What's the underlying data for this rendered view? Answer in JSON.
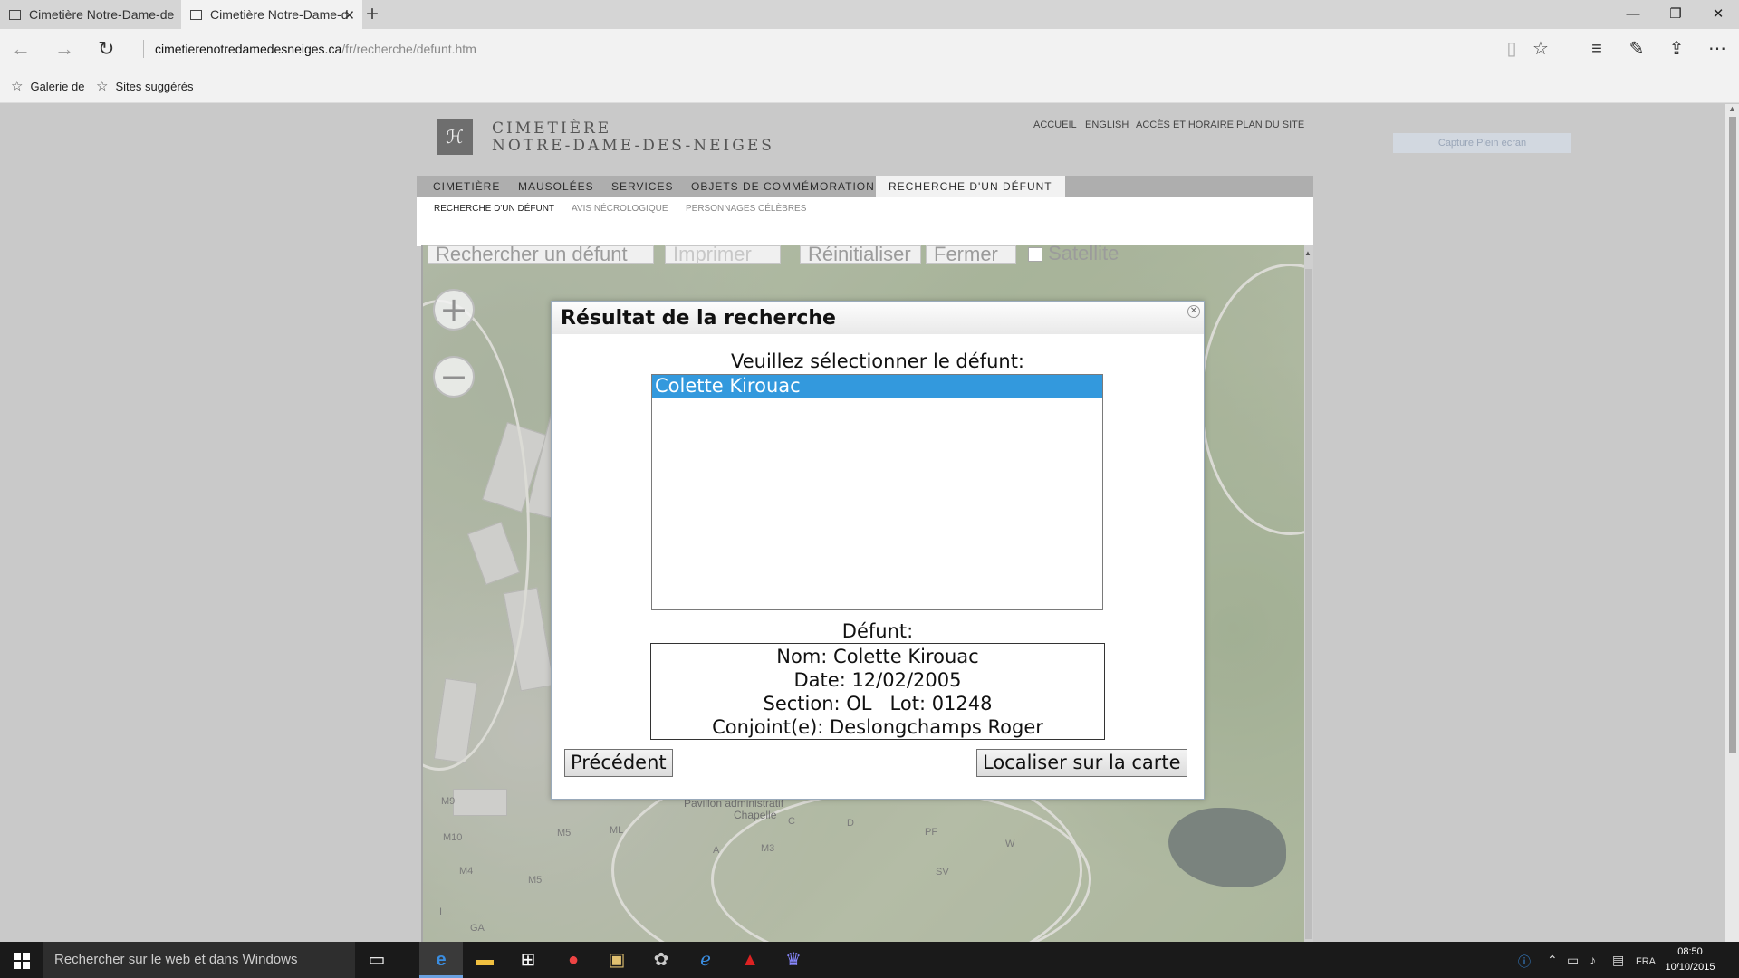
{
  "browser": {
    "tabs": [
      {
        "title": "Cimetière Notre-Dame-des-N",
        "active": false
      },
      {
        "title": "Cimetière Notre-Dame-d",
        "active": true
      }
    ],
    "url_domain": "cimetierenotredamedesneiges.ca",
    "url_path": "/fr/recherche/defunt.htm",
    "favorites": [
      "Galerie de",
      "Sites suggérés"
    ]
  },
  "site": {
    "logo_glyph": "ℋ",
    "brand_line1": "CIMETIÈRE",
    "brand_line2": "NOTRE-DAME-DES-NEIGES",
    "top_links": [
      "ACCUEIL",
      "ENGLISH",
      "ACCÈS ET HORAIRE",
      "PLAN DU SITE"
    ],
    "capture_button": "Capture Plein écran",
    "main_nav": [
      "CIMETIÈRE",
      "MAUSOLÉES",
      "SERVICES",
      "OBJETS DE COMMÉMORATION",
      "RECHERCHE D'UN DÉFUNT"
    ],
    "main_nav_active": "RECHERCHE D'UN DÉFUNT",
    "sub_nav": [
      "RECHERCHE D'UN DÉFUNT",
      "AVIS NÉCROLOGIQUE",
      "PERSONNAGES CÉLÈBRES"
    ]
  },
  "map": {
    "toolbar": [
      "Rechercher un défunt",
      "Imprimer",
      "Réinitialiser",
      "Fermer",
      "Satellite"
    ],
    "zoom_in": "+",
    "zoom_out": "−",
    "labels": [
      "Pavillon administratif",
      "Chapelle",
      "C",
      "D",
      "PF",
      "W",
      "SV",
      "A",
      "M3",
      "ML",
      "M5",
      "M9",
      "M10",
      "M4",
      "M5",
      "GA",
      "I"
    ]
  },
  "dialog": {
    "title": "Résultat de la recherche",
    "prompt": "Veuillez sélectionner le défunt:",
    "results": [
      "Colette Kirouac"
    ],
    "selected_index": 0,
    "detail_label": "Défunt:",
    "detail": {
      "nom": "Nom: Colette Kirouac",
      "date": "Date: 12/02/2005",
      "section_lot": "Section: OL   Lot: 01248",
      "conjoint": "Conjoint(e): Deslongchamps Roger"
    },
    "btn_previous": "Précédent",
    "btn_locate": "Localiser sur la carte"
  },
  "taskbar": {
    "search_placeholder": "Rechercher sur le web et dans Windows",
    "language": "FRA",
    "time": "08:50",
    "date": "10/10/2015"
  }
}
